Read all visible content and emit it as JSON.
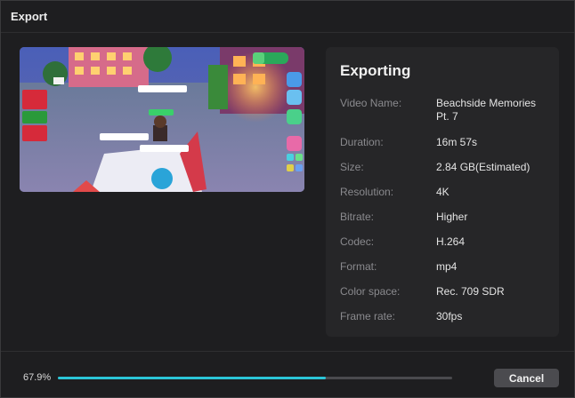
{
  "window": {
    "title": "Export"
  },
  "preview": {
    "image": "game-screenshot-thumbnail",
    "player_name": "militarynoobi",
    "player_tag": "Family",
    "money": "185",
    "event_labels": [
      "LUNAR NEW YEAR",
      "EVENT ENDS IN 8 DAYS"
    ]
  },
  "info": {
    "heading": "Exporting",
    "rows": [
      {
        "label": "Video Name:",
        "value": "Beachside Memories Pt. 7"
      },
      {
        "label": "Duration:",
        "value": "16m 57s"
      },
      {
        "label": "Size:",
        "value": "2.84 GB(Estimated)"
      },
      {
        "label": "Resolution:",
        "value": "4K"
      },
      {
        "label": "Bitrate:",
        "value": "Higher"
      },
      {
        "label": "Codec:",
        "value": "H.264"
      },
      {
        "label": "Format:",
        "value": "mp4"
      },
      {
        "label": "Color space:",
        "value": "Rec. 709 SDR"
      },
      {
        "label": "Frame rate:",
        "value": "30fps"
      }
    ]
  },
  "progress": {
    "label": "67.9%",
    "fraction": 0.679,
    "color": "#2bc6d8"
  },
  "footer": {
    "cancel_label": "Cancel"
  }
}
